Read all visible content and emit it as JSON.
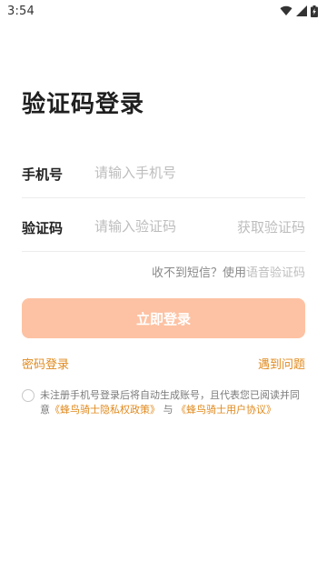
{
  "status_bar": {
    "time": "3:54",
    "icons": [
      "wifi-icon",
      "signal-icon",
      "battery-icon"
    ]
  },
  "page": {
    "title": "验证码登录"
  },
  "phone_row": {
    "label": "手机号",
    "placeholder": "请输入手机号"
  },
  "code_row": {
    "label": "验证码",
    "placeholder": "请输入验证码",
    "get_code": "获取验证码"
  },
  "voice": {
    "prefix": "收不到短信？使用",
    "link": "语音验证码"
  },
  "login_button": {
    "label": "立即登录",
    "color": "#fdc2a3"
  },
  "links": {
    "password_login": "密码登录",
    "problem": "遇到问题"
  },
  "agreement": {
    "text": "未注册手机号登录后将自动生成账号，且代表您已阅读并同意",
    "privacy": "《蜂鸟骑士隐私权政策》",
    "and": "与",
    "user_agreement": "《蜂鸟骑士用户协议》"
  },
  "colors": {
    "accent": "#e08a1e",
    "placeholder": "#bdbdbd",
    "divider": "#ececec"
  }
}
